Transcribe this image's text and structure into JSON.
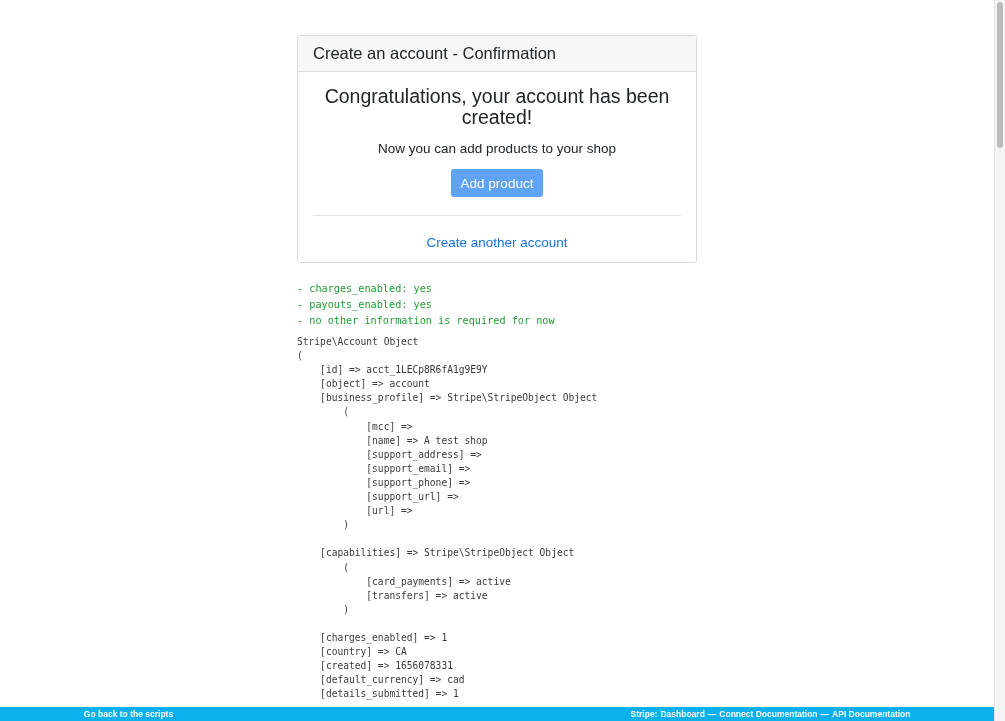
{
  "card": {
    "title": "Create an account - Confirmation",
    "heading": "Congratulations, your account has been created!",
    "subtitle": "Now you can add products to your shop",
    "primary_button": "Add product",
    "link": "Create another account"
  },
  "status_lines": [
    "- charges_enabled: yes",
    "- payouts_enabled: yes",
    "- no other information is required for now"
  ],
  "dump_blocks": [
    [
      "Stripe\\Account Object",
      "(",
      "    [id] => acct_1LECp8R6fA1g9E9Y",
      "    [object] => account",
      "    [business_profile] => Stripe\\StripeObject Object",
      "        (",
      "            [mcc] =>",
      "            [name] => A test shop",
      "            [support_address] =>",
      "            [support_email] =>",
      "            [support_phone] =>",
      "            [support_url] =>",
      "            [url] =>",
      "        )"
    ],
    [
      "    [capabilities] => Stripe\\StripeObject Object",
      "        (",
      "            [card_payments] => active",
      "            [transfers] => active",
      "        )"
    ],
    [
      "    [charges_enabled] => 1",
      "    [country] => CA",
      "    [created] => 1656078331",
      "    [default_currency] => cad",
      "    [details_submitted] => 1"
    ]
  ],
  "footer": {
    "back_link": "Go back to the scripts",
    "prefix": "Stripe:",
    "separator": "—",
    "links": [
      "Dashboard",
      "Connect Documentation",
      "API Documentation"
    ]
  }
}
